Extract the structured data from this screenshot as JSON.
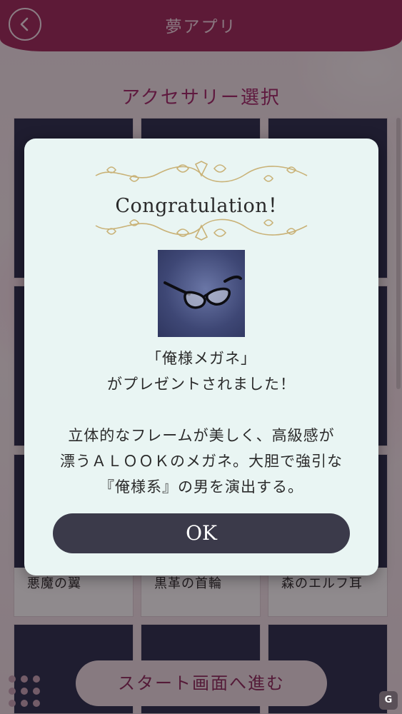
{
  "header": {
    "title": "夢アプリ"
  },
  "section": {
    "title": "アクセサリー選択"
  },
  "grid": {
    "captions": [
      "悪魔の翼",
      "黒革の首輪",
      "森のエルフ耳"
    ]
  },
  "bottom": {
    "start_label": "スタート画面へ進む"
  },
  "modal": {
    "title": "Congratulation！",
    "item_name_line": "「俺様メガネ」",
    "present_line": "がプレゼントされました！",
    "description": [
      "立体的なフレームが美しく、高級感が",
      "漂うＡＬＯＯＫのメガネ。大胆で強引な",
      "『俺様系』の男を演出する。"
    ],
    "ok_label": "OK"
  },
  "colors": {
    "header": "#a02a5a",
    "accent": "#a3286a",
    "modal_bg": "#e9f5f3",
    "ok_button": "#3b3a4a",
    "ornament": "#c9b277"
  },
  "icons": {
    "back": "chevron-left-icon",
    "menu": "grid-dots-icon",
    "item": "glasses-icon"
  }
}
